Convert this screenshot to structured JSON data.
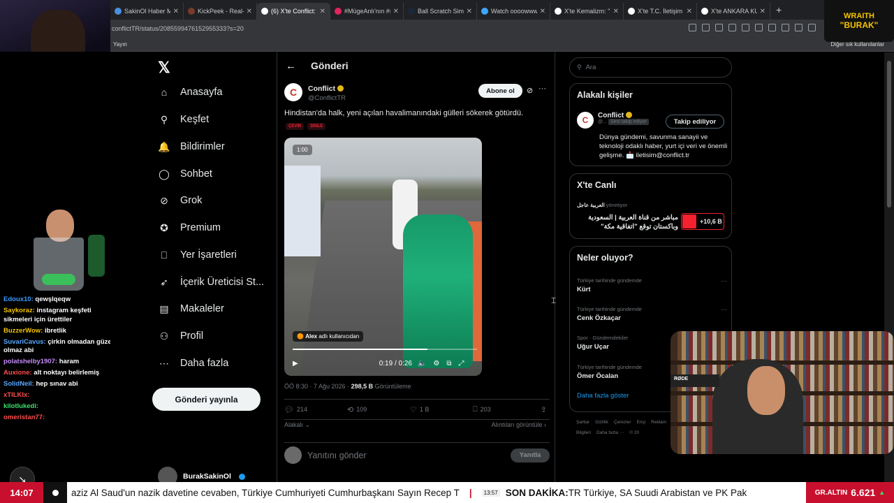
{
  "browser": {
    "tabs": [
      {
        "label": "SakinOl Haber Merk",
        "fav": "#4a90e2",
        "active": false
      },
      {
        "label": "KickPeek - Real-tim",
        "fav": "#7a3b2a",
        "active": false
      },
      {
        "label": "(6) X'te Conflict: \"Hi",
        "fav": "#ffffff",
        "active": true
      },
      {
        "label": "#MügeAnlı'nın #sar",
        "fav": "#e0245e",
        "active": false
      },
      {
        "label": "Ball Scratch Simulat",
        "fav": "#1b2838",
        "active": false
      },
      {
        "label": "Watch oooowwww",
        "fav": "#3ea6ff",
        "active": false
      },
      {
        "label": "X'te Kemalizm: \"De",
        "fav": "#ffffff",
        "active": false
      },
      {
        "label": "X'te T.C. İletişim Ba",
        "fav": "#ffffff",
        "active": false
      },
      {
        "label": "X'te ANKARA KUŞU",
        "fav": "#ffffff",
        "active": false
      }
    ],
    "url": "conflictTR/status/2085599476152955333?s=20",
    "bookmark_left": "Yayın",
    "bookmark_right": "Diğer sık kullanılanlar"
  },
  "stream": {
    "chat": [
      {
        "user": "Edoux10:",
        "text": "qewşlqeqw",
        "color": "#3b9cff"
      },
      {
        "user": "Saykoraz:",
        "text": "instagram keşfeti sikmeleri için ürettiler",
        "color": "#f5c400"
      },
      {
        "user": "BuzzerWow:",
        "text": "ibretlik",
        "color": "#f5c400"
      },
      {
        "user": "SuvariCavus:",
        "text": "çirkin olmadan güzel olmaz abi",
        "color": "#58a6ff"
      },
      {
        "user": "polatshelby1907:",
        "text": "haram",
        "color": "#c58af9"
      },
      {
        "user": "Auxione:",
        "text": "alt noktayı belirlemiş",
        "color": "#ff4d4d"
      },
      {
        "user": "SolidNeil:",
        "text": "hep sınav abi",
        "color": "#58a6ff"
      },
      {
        "user": "xTILKIx:",
        "text": "",
        "color": "#ff4d4d"
      },
      {
        "user": "kilotlukedi:",
        "text": "",
        "color": "#3be26b"
      },
      {
        "user": "omeristan77:",
        "text": "",
        "color": "#ff4d4d"
      }
    ],
    "overlay_title_1": "WRAITH",
    "overlay_title_2": "\"BURAK\"",
    "webcam_label": "RØDE"
  },
  "nav": {
    "items": [
      {
        "label": "Anasayfa",
        "icon": "home-icon",
        "glyph": "⌂"
      },
      {
        "label": "Keşfet",
        "icon": "search-icon",
        "glyph": "⚲"
      },
      {
        "label": "Bildirimler",
        "icon": "bell-icon",
        "glyph": "🔔"
      },
      {
        "label": "Sohbet",
        "icon": "chat-icon",
        "glyph": "◯"
      },
      {
        "label": "Grok",
        "icon": "grok-icon",
        "glyph": "⊘"
      },
      {
        "label": "Premium",
        "icon": "premium-icon",
        "glyph": "✪"
      },
      {
        "label": "Yer İşaretleri",
        "icon": "bookmark-icon",
        "glyph": "⎕"
      },
      {
        "label": "İçerik Üreticisi St...",
        "icon": "rocket-icon",
        "glyph": "➶"
      },
      {
        "label": "Makaleler",
        "icon": "article-icon",
        "glyph": "▤"
      },
      {
        "label": "Profil",
        "icon": "profile-icon",
        "glyph": "⚇"
      },
      {
        "label": "Daha fazla",
        "icon": "more-icon",
        "glyph": "⋯"
      }
    ],
    "post_button": "Gönderi yayınla",
    "account_name": "BurakSakinOl"
  },
  "post": {
    "header_title": "Gönderi",
    "author_name": "Conflict",
    "author_handle": "@ConflictTR",
    "subscribe": "Abone ol",
    "text": "Hindistan'da halk, yeni açılan havalimanındaki gülleri sökerek götürdü.",
    "tags": [
      "ÇEVİR",
      "DİNLE"
    ],
    "video": {
      "badge": "1:00",
      "credit_name": "Alex",
      "credit_suffix": "adlı kullanıcıdan",
      "time": "0:19 / 0:26",
      "progress": 0.73
    },
    "meta_time": "ÖÖ 8:30 · 7 Ağu 2026 · ",
    "meta_views": "298,5 B",
    "meta_views_label": " Görüntüleme",
    "stats": {
      "replies": "214",
      "reposts": "109",
      "likes": "1 B",
      "bookmarks": "203"
    },
    "relevance": "Alakalı",
    "quotes": "Alıntıları görüntüle",
    "reply_placeholder": "Yanıtını gönder",
    "reply_button": "Yanıtla"
  },
  "right": {
    "search_placeholder": "Ara",
    "related": {
      "title": "Alakalı kişiler",
      "name": "Conflict",
      "sub": "@...",
      "chip": "Seni takip ediyor",
      "follow": "Takip ediliyor",
      "bio": "Dünya gündemi, savunma sanayii ve teknoloji odaklı haber, yurt içi veri ve önemli gelişme. 📩 iletisim@conflict.tr"
    },
    "live": {
      "title": "X'te Canlı",
      "host": "العربية عاجل",
      "host_suffix": "yönetiyor",
      "headline": "مباشر من قناة العربية | السعودية وباكستان توقع \"اتفاقية مكة\"",
      "count": "+10,6 B"
    },
    "trends": {
      "title": "Neler oluyor?",
      "items": [
        {
          "context": "Türkiye tarihinde gündemde",
          "name": "Kürt"
        },
        {
          "context": "Türkiye tarihinde gündemde",
          "name": "Cenk Özkaçar"
        },
        {
          "context": "Spor · Gündemdekiler",
          "name": "Uğur Uçar"
        },
        {
          "context": "Türkiye tarihinde gündemde",
          "name": "Ömer Öcalan"
        }
      ],
      "show_more": "Daha fazla göster"
    },
    "footer": [
      "Şartlar",
      "Gizlilik",
      "Çerezler",
      "Erişi",
      "Reklam Bilgileri",
      "Daha fazla ···",
      "© 20"
    ]
  },
  "ticker": {
    "clock": "14:07",
    "text1": "aziz Al Saud'un nazik davetine cevaben, Türkiye Cumhuriyeti Cumhurbaşkanı Sayın Recep T",
    "time2": "13:57",
    "text2_bold": "SON DAKİKA:",
    "text2": " TR Türkiye, SA Suudi Arabistan ve PK Pak",
    "gold_label": "GR.ALTIN",
    "gold_value": "6.621",
    "gold_arrow": "▲"
  },
  "colors": {
    "accent_blue": "#1d9bf0",
    "red": "#c8102e",
    "gold": "#f5c400"
  }
}
